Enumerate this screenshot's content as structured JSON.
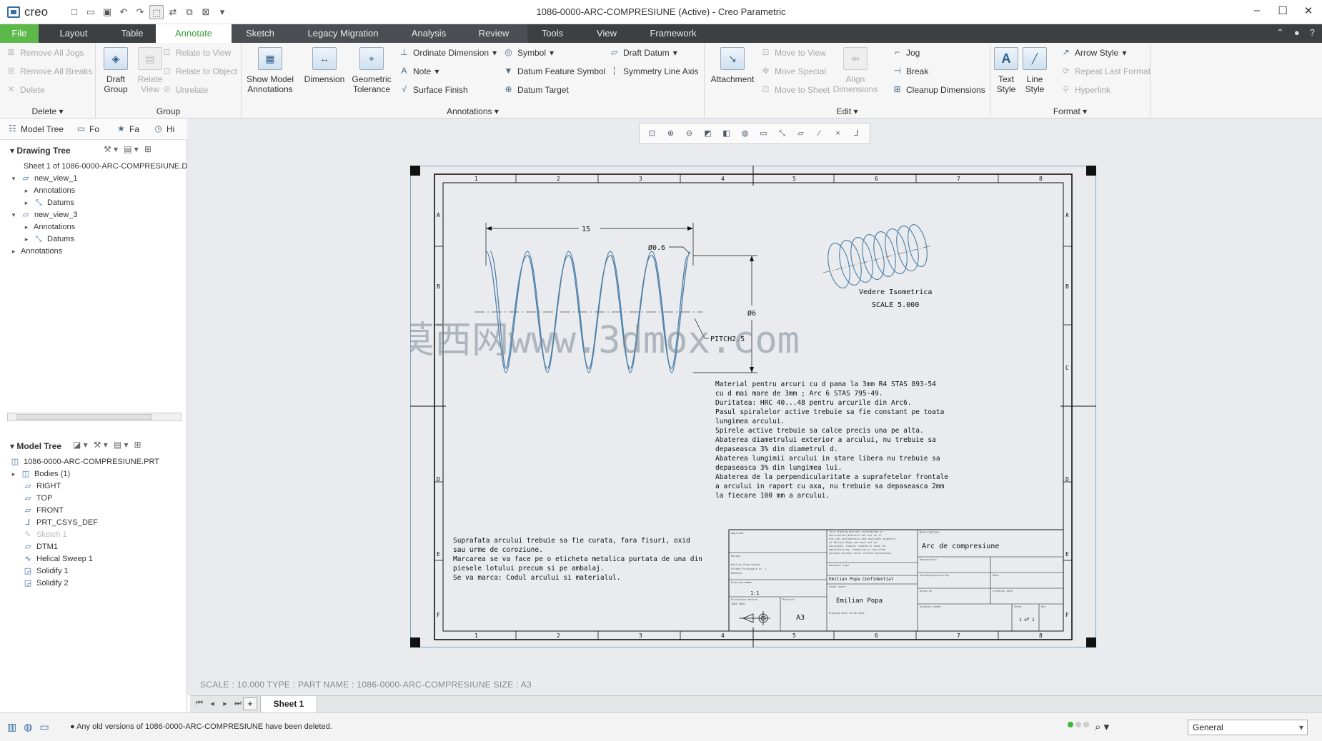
{
  "window": {
    "app_name": "creo",
    "title": "1086-0000-ARC-COMPRESIUNE (Active) - Creo Parametric"
  },
  "tabs": [
    {
      "label": "File"
    },
    {
      "label": "Layout"
    },
    {
      "label": "Table"
    },
    {
      "label": "Annotate"
    },
    {
      "label": "Sketch"
    },
    {
      "label": "Legacy Migration"
    },
    {
      "label": "Analysis"
    },
    {
      "label": "Review"
    },
    {
      "label": "Tools"
    },
    {
      "label": "View"
    },
    {
      "label": "Framework"
    }
  ],
  "ribbon": {
    "delete_group": {
      "label": "Delete",
      "items": [
        "Remove All Jogs",
        "Remove All Breaks",
        "Delete"
      ]
    },
    "group_group": {
      "label": "Group",
      "draft_group": "Draft Group",
      "relate_view": "Relate View",
      "items": [
        "Relate to View",
        "Relate to Object",
        "Unrelate"
      ]
    },
    "annotations_group": {
      "label": "Annotations",
      "show_model": "Show Model Annotations",
      "dimension": "Dimension",
      "geometric_tolerance": "Geometric Tolerance",
      "items": [
        "Ordinate Dimension",
        "Note",
        "Surface Finish",
        "Symbol",
        "Datum Feature Symbol",
        "Datum Target",
        "Draft Datum",
        "Symmetry Line Axis"
      ]
    },
    "edit_group": {
      "label": "Edit",
      "attachment": "Attachment",
      "align_dimensions": "Align Dimensions",
      "items": [
        "Move to View",
        "Move Special",
        "Move to Sheet",
        "Jog",
        "Break",
        "Cleanup Dimensions"
      ]
    },
    "format_group": {
      "label": "Format",
      "text_style": "Text Style",
      "line_style": "Line Style",
      "items": [
        "Arrow Style",
        "Repeat Last Format",
        "Hyperlink"
      ]
    }
  },
  "left_panel": {
    "tabs": [
      "Model Tree",
      "Fo",
      "Fa",
      "Hi"
    ],
    "drawing_tree": {
      "title": "Drawing Tree",
      "nodes": [
        {
          "label": "Sheet 1 of 1086-0000-ARC-COMPRESIUNE.D"
        },
        {
          "label": "new_view_1"
        },
        {
          "label": "Annotations"
        },
        {
          "label": "Datums"
        },
        {
          "label": "new_view_3"
        },
        {
          "label": "Annotations"
        },
        {
          "label": "Datums"
        },
        {
          "label": "Annotations"
        }
      ]
    },
    "model_tree": {
      "title": "Model Tree",
      "nodes": [
        {
          "label": "1086-0000-ARC-COMPRESIUNE.PRT"
        },
        {
          "label": "Bodies (1)"
        },
        {
          "label": "RIGHT"
        },
        {
          "label": "TOP"
        },
        {
          "label": "FRONT"
        },
        {
          "label": "PRT_CSYS_DEF"
        },
        {
          "label": "Sketch 1"
        },
        {
          "label": "DTM1"
        },
        {
          "label": "Helical Sweep 1"
        },
        {
          "label": "Solidify 1"
        },
        {
          "label": "Solidify 2"
        }
      ]
    }
  },
  "drawing": {
    "zone_numbers": [
      "1",
      "2",
      "3",
      "4",
      "5",
      "6",
      "7",
      "8"
    ],
    "zone_letters": [
      "A",
      "B",
      "C",
      "D",
      "E",
      "F"
    ],
    "dim_length": "15",
    "dim_wire": "Ø0.6",
    "dim_diameter": "Ø6",
    "pitch": "PITCH2.5",
    "iso_title": "Vedere Isometrica",
    "iso_scale": "SCALE 5.000",
    "watermark": "莫西网www.3dmox.com",
    "notes": [
      "Material pentru arcuri cu d pana la 3mm R4 STAS 893-54",
      "cu d mai mare de 3mm ; Arc 6 STAS 795-49.",
      "Duritatea: HRC 40...48 pentru arcurile din Arc6.",
      "Pasul spiralelor active trebuie sa fie constant pe toata",
      "lungimea arcului.",
      "Spirele active trebuie sa calce precis una pe alta.",
      "Abaterea diametrului exterior a arcului, nu trebuie sa",
      "depaseasca 3% din diametrul d.",
      "Abaterea lungimii arcului in stare libera nu trebuie sa",
      "depaseasca 3% din lungimea lui.",
      "Abaterea de la perpendicularitate a suprafetelor frontale",
      "a arcului in raport cu axa, nu trebuie sa depaseasca 2mm",
      "la fiecare 100 mm a arcului."
    ],
    "surface_notes": [
      "Suprafata arcului trebuie sa fie curata, fara fisuri, oxid",
      "sau urme de coroziune.",
      "Marcarea se va face pe o eticheta metalica purtata de una din",
      "piesele lotului precum si pe ambalaj.",
      "Se va marca: Codul arcului si materialul."
    ],
    "title_block": {
      "description_label": "Description:",
      "description": "Arc de compresiune",
      "confidential": "Emilian Popa Confidential",
      "author": "Emilian Popa",
      "size": "A3",
      "scale": "1:1",
      "sheet": "1 of 1"
    }
  },
  "status": {
    "info": "SCALE : 10.000    TYPE : PART    NAME : 1086-0000-ARC-COMPRESIUNE    SIZE : A3",
    "sheet_tab": "Sheet 1",
    "message": "Any old versions of 1086-0000-ARC-COMPRESIUNE have been deleted.",
    "filter": "General"
  },
  "colors": {
    "file_tab": "#5db84a",
    "active_tab_text": "#3a9a3a",
    "tabbar": "#3c4043",
    "geometry": "#4d7fa8",
    "background": "#e9ebee"
  }
}
